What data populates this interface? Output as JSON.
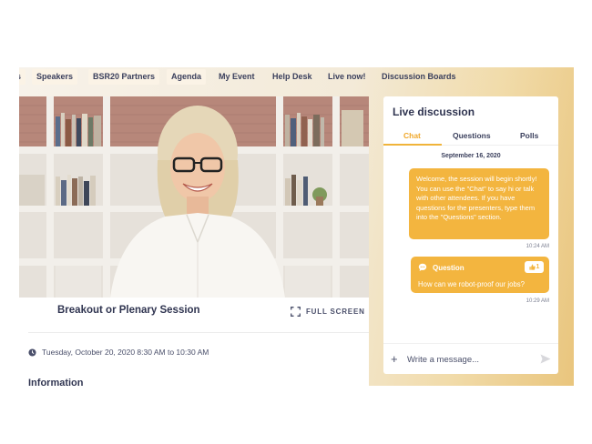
{
  "nav": {
    "items": [
      {
        "label": "s"
      },
      {
        "label": "Speakers"
      },
      {
        "label": "BSR20 Partners"
      },
      {
        "label": "Agenda"
      },
      {
        "label": "My Event"
      },
      {
        "label": "Help Desk"
      },
      {
        "label": "Live now!"
      },
      {
        "label": "Discussion Boards"
      }
    ]
  },
  "session": {
    "title": "Breakout or Plenary Session",
    "fullscreen_label": "FULL SCREEN",
    "datetime": "Tuesday, October 20, 2020 8:30 AM to 10:30 AM",
    "info_heading": "Information"
  },
  "discussion": {
    "title": "Live discussion",
    "tabs": [
      {
        "label": "Chat",
        "active": true
      },
      {
        "label": "Questions"
      },
      {
        "label": "Polls"
      }
    ],
    "date": "September 16, 2020",
    "welcome_message": "Welcome, the session will begin shortly! You can use the \"Chat\" to say hi or talk with other attendees. If you have questions for the presenters, type them into the \"Questions\" section.",
    "welcome_time": "10:24 AM",
    "question": {
      "label": "Question",
      "text": "How can we robot-proof our jobs?",
      "upvotes": "1"
    },
    "question_time": "10:29 AM",
    "input_placeholder": "Write a message..."
  },
  "colors": {
    "accent": "#f3b53f",
    "text_dark": "#2f3450"
  },
  "icons": [
    "plus-icon",
    "send-icon",
    "fullscreen-icon",
    "clock-icon",
    "chat-bubble-icon",
    "thumbs-up-icon"
  ]
}
